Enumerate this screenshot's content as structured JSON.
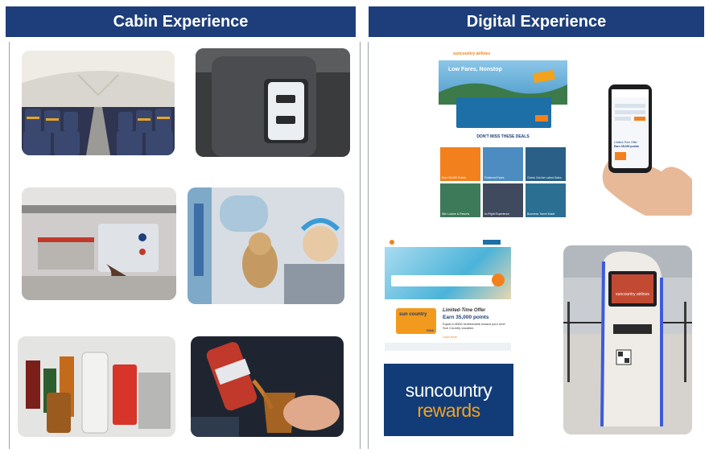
{
  "left_panel": {
    "title": "Cabin Experience"
  },
  "right_panel": {
    "title": "Digital Experience"
  },
  "website": {
    "brand": "suncountry airlines",
    "hero": "Low Fares, Nonstop",
    "deals_heading": "DON'T MISS THESE DEALS",
    "tiles": [
      "Earn 35,000 Points",
      "Preferred Fares",
      "Check Out the Latest Sales",
      "Win Lodure & Resorts",
      "In-Flight Experience",
      "Business Travel Made"
    ]
  },
  "offer_page": {
    "title": "Limited-Time Offer",
    "headline": "Earn 35,000 points",
    "body": "Equal to $350 redeemable toward your next Sun Country vacation.",
    "card_brand": "sun country",
    "card_network": "VISA",
    "cta": "Learn More"
  },
  "phone": {
    "title": "Limited-Time Offer",
    "text": "Earn 35,000 points"
  },
  "rewards_logo": {
    "line1": "suncountry",
    "line2": "rewards"
  },
  "kiosk": {
    "brand": "suncountry airlines"
  },
  "colors": {
    "banner": "#1d3e7a",
    "brand_orange": "#f2811d",
    "rewards_blue": "#123c78"
  }
}
